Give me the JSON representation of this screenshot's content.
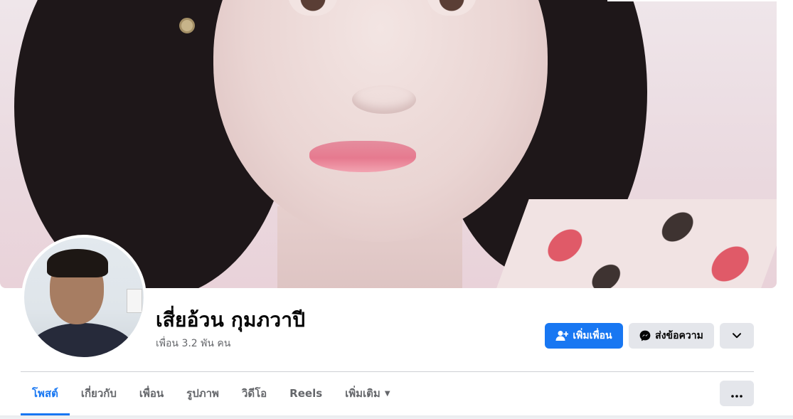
{
  "profile": {
    "name": "เสี่ยอ้วน กุมภวาปี",
    "friends_count": "เพื่อน 3.2 พัน คน"
  },
  "actions": {
    "add_friend_label": "เพิ่มเพื่อน",
    "message_label": "ส่งข้อความ"
  },
  "tabs": [
    {
      "label": "โพสต์",
      "active": true
    },
    {
      "label": "เกี่ยวกับ",
      "active": false
    },
    {
      "label": "เพื่อน",
      "active": false
    },
    {
      "label": "รูปภาพ",
      "active": false
    },
    {
      "label": "วิดีโอ",
      "active": false
    },
    {
      "label": "Reels",
      "active": false
    },
    {
      "label": "เพิ่มเติม",
      "active": false
    }
  ],
  "icons": {
    "add_friend": "person-plus-icon",
    "message": "messenger-icon",
    "more_actions": "chevron-down-icon",
    "tabs_more": "ellipsis-icon",
    "more_tab_caret": "caret-down-icon"
  },
  "colors": {
    "accent": "#1877f2",
    "secondary_button": "#e4e6eb",
    "muted_text": "#65676b"
  }
}
